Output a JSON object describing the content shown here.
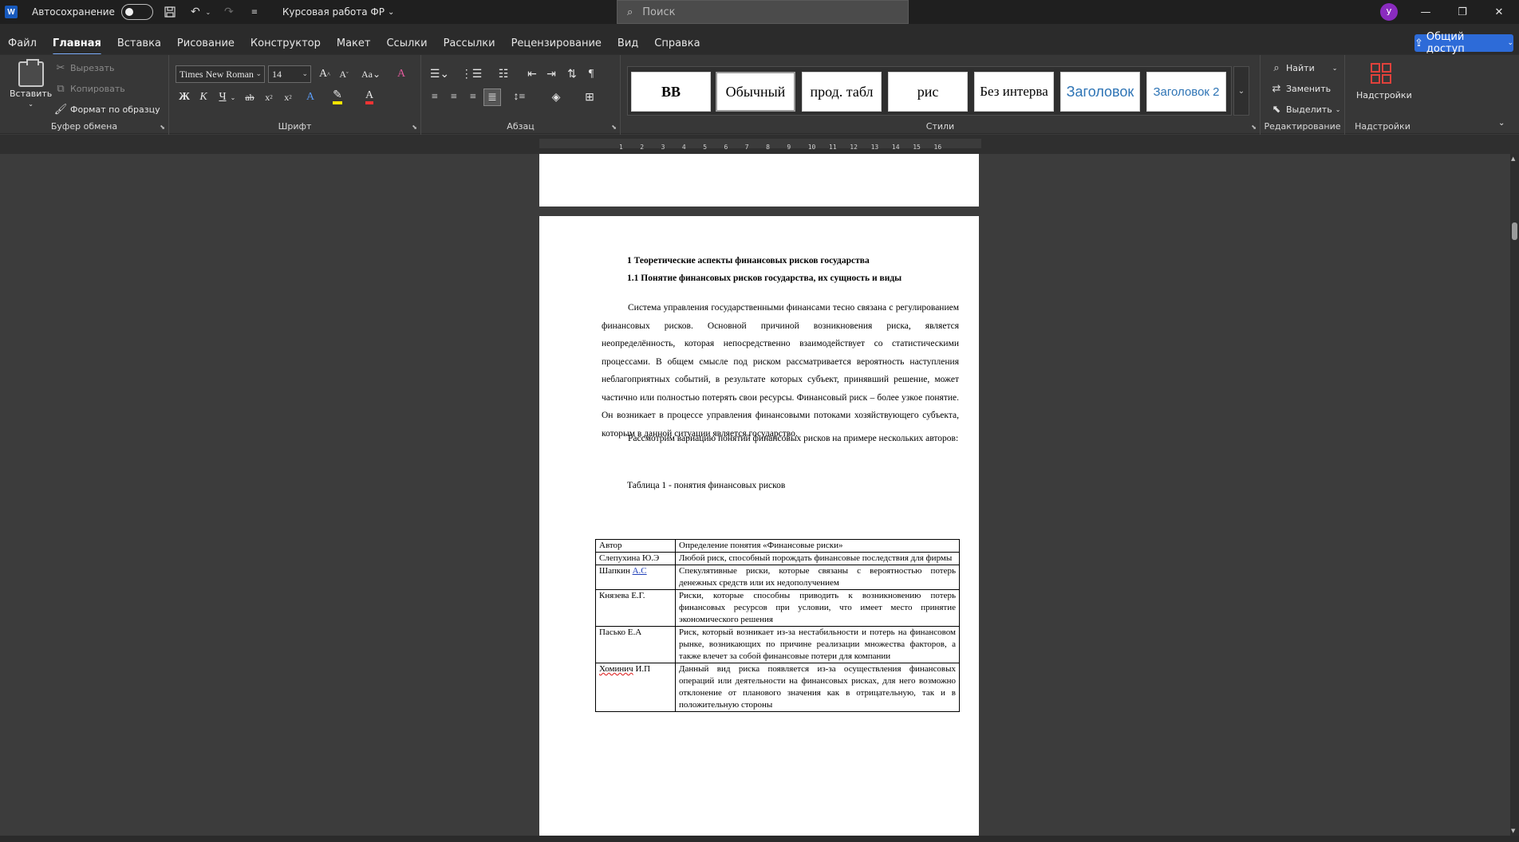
{
  "titlebar": {
    "autosave_label": "Автосохранение",
    "doc_title": "Курсовая работа ФР",
    "search_placeholder": "Поиск",
    "avatar_initial": "У"
  },
  "menu": {
    "tabs": [
      "Файл",
      "Главная",
      "Вставка",
      "Рисование",
      "Конструктор",
      "Макет",
      "Ссылки",
      "Рассылки",
      "Рецензирование",
      "Вид",
      "Справка"
    ],
    "active_tab": "Главная",
    "share_label": "Общий доступ"
  },
  "ribbon": {
    "clipboard": {
      "label": "Буфер обмена",
      "paste": "Вставить",
      "cut": "Вырезать",
      "copy": "Копировать",
      "format_painter": "Формат по образцу"
    },
    "font": {
      "label": "Шрифт",
      "font_name": "Times New Roman",
      "font_size": "14",
      "bold": "Ж",
      "italic": "К",
      "underline": "Ч"
    },
    "paragraph": {
      "label": "Абзац"
    },
    "styles": {
      "label": "Стили",
      "items": [
        "BB",
        "Обычный",
        "прод. табл",
        "рис",
        "Без интерва",
        "Заголовок",
        "Заголовок 2"
      ]
    },
    "editing": {
      "label": "Редактирование",
      "find": "Найти",
      "replace": "Заменить",
      "select": "Выделить"
    },
    "addins": {
      "label": "Надстройки",
      "button": "Надстройки"
    }
  },
  "ruler": {
    "numbers": [
      "1",
      "2",
      "3",
      "4",
      "5",
      "6",
      "7",
      "8",
      "9",
      "10",
      "11",
      "12",
      "13",
      "14",
      "15",
      "16"
    ]
  },
  "document": {
    "heading1": "1 Теоретические аспекты финансовых рисков государства",
    "heading2": "1.1 Понятие финансовых рисков государства, их сущность и виды",
    "paragraph1": "Система управления государственными финансами тесно связана с регулированием финансовых рисков. Основной причиной возникновения риска, является неопределённость, которая непосредственно взаимодействует со статистическими процессами. В общем смысле под риском рассматривается вероятность наступления неблагоприятных событий, в результате которых субъект, принявший решение, может частично или полностью потерять свои ресурсы. Финансовый риск – более узкое понятие. Он возникает в процессе управления финансовыми потоками хозяйствующего субъекта, которым в данной ситуации является государство.",
    "paragraph2": "Рассмотрим вариацию понятий финансовых рисков на примере нескольких авторов:",
    "table_caption": "Таблица 1 - понятия финансовых рисков",
    "table": {
      "header": [
        "Автор",
        "Определение понятия «Финансовые риски»"
      ],
      "rows": [
        [
          "Слепухина Ю.Э",
          "Любой риск, способный порождать финансовые последствия для фирмы"
        ],
        [
          "Шапкин А.С",
          "Спекулятивные риски, которые связаны с вероятностью потерь денежных средств или их недополучением"
        ],
        [
          "Князева Е.Г.",
          "Риски, которые способны приводить к возникновению потерь финансовых ресурсов при условии, что имеет место принятие экономического решения"
        ],
        [
          "Пасько Е.А",
          "Риск, который возникает из-за нестабильности и потерь на финансовом рынке, возникающих по причине реализации множества факторов, а также влечет за собой финансовые потери для компании"
        ],
        [
          "Хоминич И.П",
          "Данный вид риска появляется из-за осуществления финансовых операций или деятельности на финансовых рисках, для него возможно отклонение от планового значения как в отрицательную, так и в положительную стороны"
        ]
      ]
    }
  }
}
